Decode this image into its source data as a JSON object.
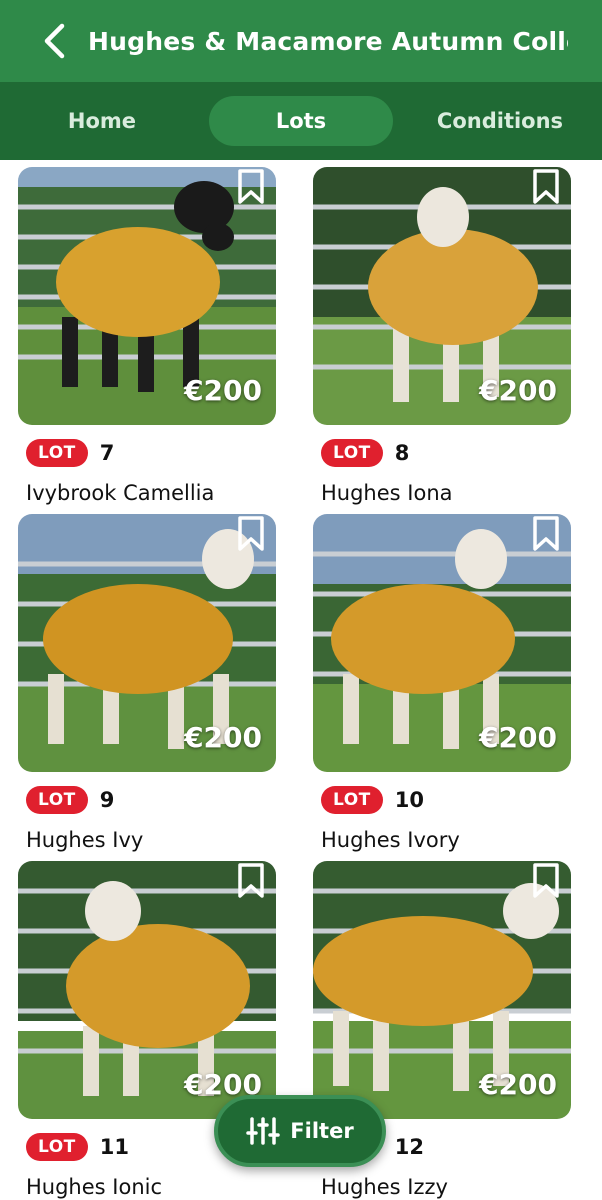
{
  "header": {
    "title": "Hughes & Macamore Autumn Collec..."
  },
  "tabs": [
    {
      "label": "Home",
      "active": false
    },
    {
      "label": "Lots",
      "active": true
    },
    {
      "label": "Conditions",
      "active": false
    }
  ],
  "lot_badge_text": "LOT",
  "lots": [
    {
      "number": "7",
      "name": "Ivybrook Camellia",
      "price": "€200",
      "face": "black"
    },
    {
      "number": "8",
      "name": "Hughes Iona",
      "price": "€200",
      "face": "white"
    },
    {
      "number": "9",
      "name": "Hughes Ivy",
      "price": "€200",
      "face": "white"
    },
    {
      "number": "10",
      "name": "Hughes Ivory",
      "price": "€200",
      "face": "white"
    },
    {
      "number": "11",
      "name": "Hughes Ionic",
      "price": "€200",
      "face": "white"
    },
    {
      "number": "12",
      "name": "Hughes Izzy",
      "price": "€200",
      "face": "white"
    }
  ],
  "filter": {
    "label": "Filter"
  },
  "colors": {
    "header_bg": "#2f8a49",
    "tabs_bg": "#1f6a34",
    "active_tab": "#2f8a49",
    "lot_badge": "#e0202e",
    "fleece": "#d8a12e"
  },
  "icons": {
    "back": "chevron-left-icon",
    "bookmark": "bookmark-icon",
    "filter": "sliders-icon"
  }
}
